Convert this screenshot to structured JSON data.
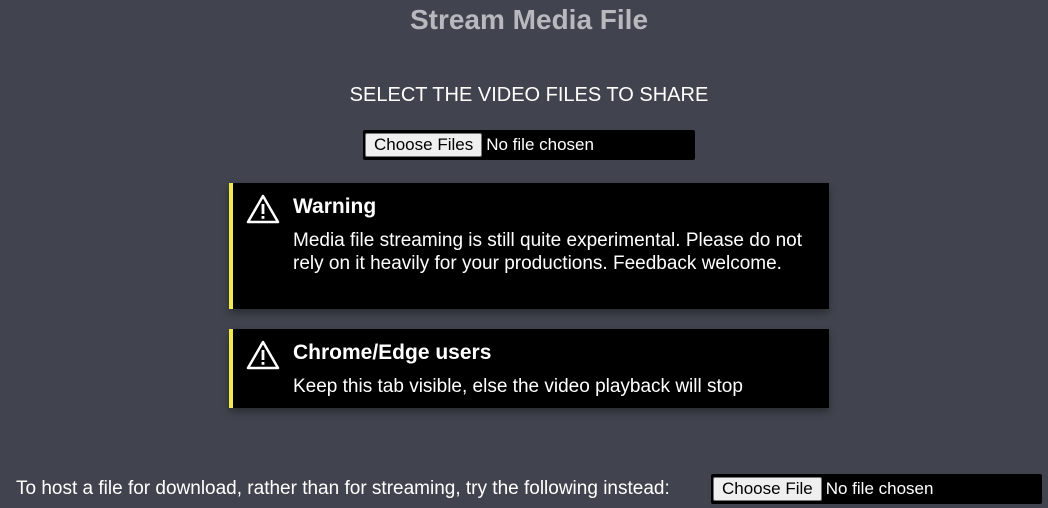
{
  "page": {
    "title": "Stream Media File",
    "section_title": "SELECT THE VIDEO FILES TO SHARE"
  },
  "main_picker": {
    "button_label": "Choose Files",
    "status": "No file chosen"
  },
  "notices": [
    {
      "icon": "warning-triangle-icon",
      "title": "Warning",
      "body": "Media file streaming is still quite experimental. Please do not rely on it heavily for your productions. Feedback welcome."
    },
    {
      "icon": "warning-triangle-icon",
      "title": "Chrome/Edge users",
      "body": "Keep this tab visible, else the video playback will stop"
    }
  ],
  "download": {
    "prompt": "To host a file for download, rather than for streaming, try the following instead:",
    "button_label": "Choose File",
    "status": "No file chosen"
  },
  "colors": {
    "background": "#41444e",
    "notice_accent": "#f2ea4b",
    "notice_background": "#000000",
    "title_color": "#b8b9be"
  }
}
